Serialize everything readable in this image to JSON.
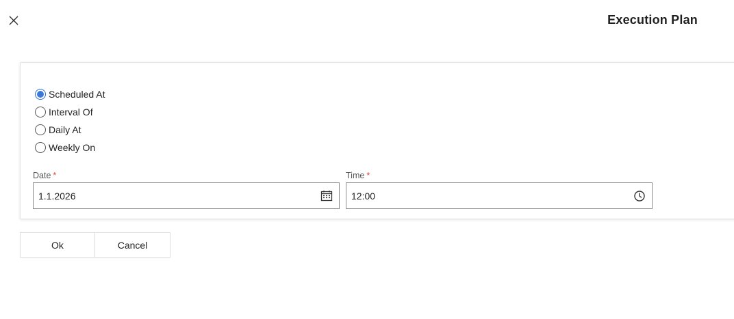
{
  "header": {
    "title": "Execution Plan",
    "close_icon": "close-icon"
  },
  "schedule": {
    "options": [
      {
        "label": "Scheduled At",
        "checked": true
      },
      {
        "label": "Interval Of",
        "checked": false
      },
      {
        "label": "Daily At",
        "checked": false
      },
      {
        "label": "Weekly On",
        "checked": false
      }
    ],
    "date": {
      "label": "Date",
      "required_mark": "*",
      "value": "1.1.2026",
      "icon": "calendar-icon"
    },
    "time": {
      "label": "Time",
      "required_mark": "*",
      "value": "12:00",
      "icon": "clock-icon"
    }
  },
  "actions": {
    "ok_label": "Ok",
    "cancel_label": "Cancel"
  },
  "colors": {
    "accent": "#3b78d8",
    "required": "#d2473b"
  }
}
